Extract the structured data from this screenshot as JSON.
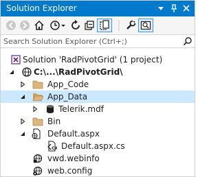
{
  "window": {
    "title": "Solution Explorer"
  },
  "search": {
    "placeholder": "Search Solution Explorer (Ctrl+;)"
  },
  "tree": {
    "solution": "Solution 'RadPivotGrid' (1 project)",
    "project": "C:\\...\\RadPivotGrid\\",
    "app_code": "App_Code",
    "app_data": "App_Data",
    "telerik_mdf": "Telerik.mdf",
    "bin": "Bin",
    "default_aspx": "Default.aspx",
    "default_aspx_cs": "Default.aspx.cs",
    "vwd_webinfo": "vwd.webinfo",
    "web_config": "web.config"
  },
  "colors": {
    "accent": "#007acc",
    "selection": "#cce8ff",
    "folder": "#dcb67a"
  }
}
